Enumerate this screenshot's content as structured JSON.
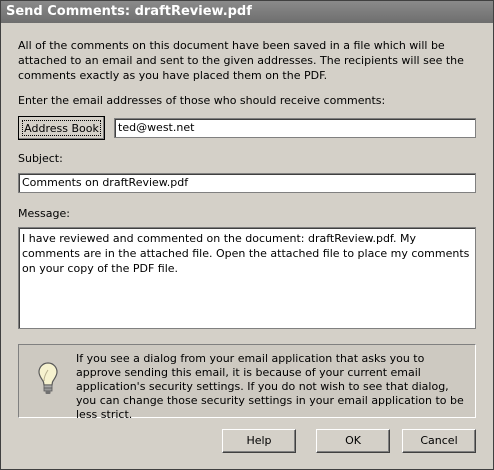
{
  "window": {
    "title": "Send Comments: draftReview.pdf"
  },
  "intro_text": "All of the comments on this document have been saved in a file which will be attached to an email and sent to the given addresses. The recipients will see the comments exactly as you have placed them on the PDF.",
  "recipients": {
    "prompt": "Enter the email addresses of those who should receive comments:",
    "address_book_label": "Address Book",
    "to_value": "ted@west.net"
  },
  "subject": {
    "label": "Subject:",
    "value": "Comments on draftReview.pdf"
  },
  "message": {
    "label": "Message:",
    "value": "I have reviewed and commented on the document: draftReview.pdf. My comments are in the attached file. Open the attached file to place my comments on your copy of the PDF file."
  },
  "info": {
    "icon": "lightbulb-icon",
    "text": "If you see a dialog from your email application that asks you to approve sending this email, it is because of your current email application's security settings.  If you do not wish to see that dialog, you can change those security settings in your email application to be less strict."
  },
  "buttons": {
    "help": "Help",
    "ok": "OK",
    "cancel": "Cancel"
  }
}
